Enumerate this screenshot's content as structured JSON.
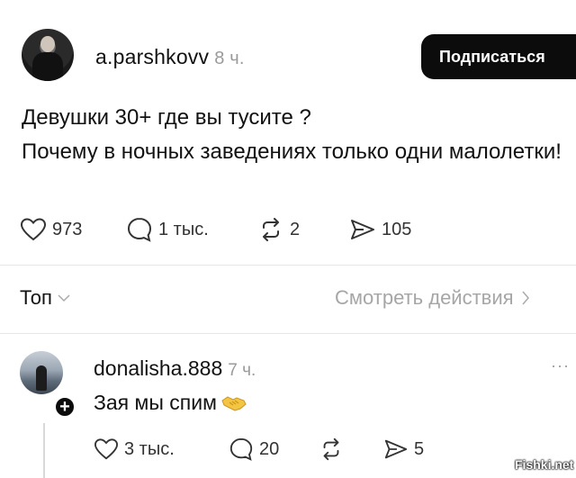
{
  "post": {
    "username": "a.parshkovv",
    "time": "8 ч.",
    "follow_label": "Подписаться",
    "text_line1": "Девушки 30+ где вы тусите ?",
    "text_line2": "Почему в ночных заведениях только  одни малолетки!",
    "likes": "973",
    "comments": "1 тыс.",
    "reposts": "2",
    "shares": "105"
  },
  "sort": {
    "label": "Топ",
    "see_actions": "Смотреть действия"
  },
  "comment": {
    "username": "donalisha.888",
    "time": "7 ч.",
    "more": "···",
    "text": "Зая мы спим",
    "likes": "3 тыс.",
    "replies": "20",
    "shares": "5",
    "plus": "+"
  },
  "watermark": "Fishki.net",
  "colors": {
    "follow_bg": "#0c0c0c",
    "muted": "#9a9a9a",
    "text": "#111111"
  }
}
